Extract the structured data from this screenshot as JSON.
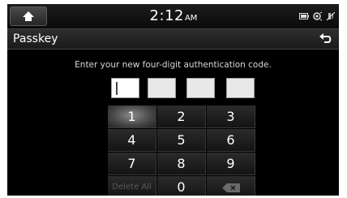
{
  "status": {
    "time": "2:12",
    "ampm": "AM"
  },
  "header": {
    "title": "Passkey"
  },
  "instruction": "Enter your new four-digit authentication code.",
  "code": {
    "entered": [
      "",
      "",
      "",
      ""
    ]
  },
  "keypad": {
    "keys": [
      "1",
      "2",
      "3",
      "4",
      "5",
      "6",
      "7",
      "8",
      "9"
    ],
    "delete_all": "Delete All",
    "zero": "0"
  },
  "icons": {
    "home": "home-icon",
    "back": "back-icon",
    "battery": "battery-icon",
    "signal": "signal-icon",
    "mute": "mute-icon",
    "backspace": "backspace-icon"
  }
}
